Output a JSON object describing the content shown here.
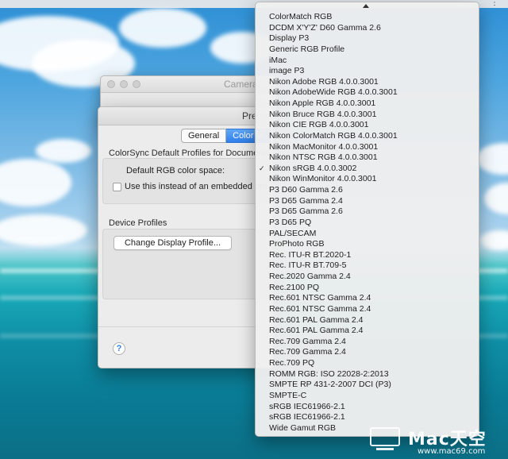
{
  "back_window": {
    "title": "Camera"
  },
  "prefs_window": {
    "title": "Pre",
    "tabs": [
      {
        "label": "General",
        "active": false
      },
      {
        "label": "Color M",
        "active": true
      }
    ],
    "colorsync_section": {
      "title": "ColorSync Default Profiles for Documents",
      "default_rgb_label": "Default RGB color space:",
      "embedded_checkbox_label": "Use this instead of an embedded pro",
      "embedded_checkbox_checked": false
    },
    "device_section": {
      "title": "Device Profiles",
      "change_button_label": "Change Display Profile..."
    },
    "help_label": "?"
  },
  "menu": {
    "checkmark": "✓",
    "selected_index": 14,
    "items": [
      "ColorMatch RGB",
      "DCDM X'Y'Z' D60 Gamma 2.6",
      "Display P3",
      "Generic RGB Profile",
      "iMac",
      "image P3",
      "Nikon Adobe RGB 4.0.0.3001",
      "Nikon AdobeWide RGB 4.0.0.3001",
      "Nikon Apple RGB 4.0.0.3001",
      "Nikon Bruce RGB 4.0.0.3001",
      "Nikon CIE RGB 4.0.0.3001",
      "Nikon ColorMatch RGB 4.0.0.3001",
      "Nikon MacMonitor 4.0.0.3001",
      "Nikon NTSC RGB 4.0.0.3001",
      "Nikon sRGB 4.0.0.3002",
      "Nikon WinMonitor 4.0.0.3001",
      "P3 D60 Gamma 2.6",
      "P3 D65 Gamma 2.4",
      "P3 D65 Gamma 2.6",
      "P3 D65 PQ",
      "PAL/SECAM",
      "ProPhoto RGB",
      "Rec. ITU-R BT.2020-1",
      "Rec. ITU-R BT.709-5",
      "Rec.2020 Gamma 2.4",
      "Rec.2100 PQ",
      "Rec.601 NTSC Gamma 2.4",
      "Rec.601 NTSC Gamma 2.4",
      "Rec.601 PAL Gamma 2.4",
      "Rec.601 PAL Gamma 2.4",
      "Rec.709 Gamma 2.4",
      "Rec.709 Gamma 2.4",
      "Rec.709 PQ",
      "ROMM RGB: ISO 22028-2:2013",
      "SMPTE RP 431-2-2007 DCI (P3)",
      "SMPTE-C",
      "sRGB IEC61966-2.1",
      "sRGB IEC61966-2.1",
      "Wide Gamut RGB"
    ]
  },
  "watermark": {
    "title": "Mac天空",
    "url": "www.mac69.com"
  },
  "colors": {
    "accent": "#2f7fea",
    "menu_bg": "#eeeeee",
    "window_bg": "#ececec"
  }
}
